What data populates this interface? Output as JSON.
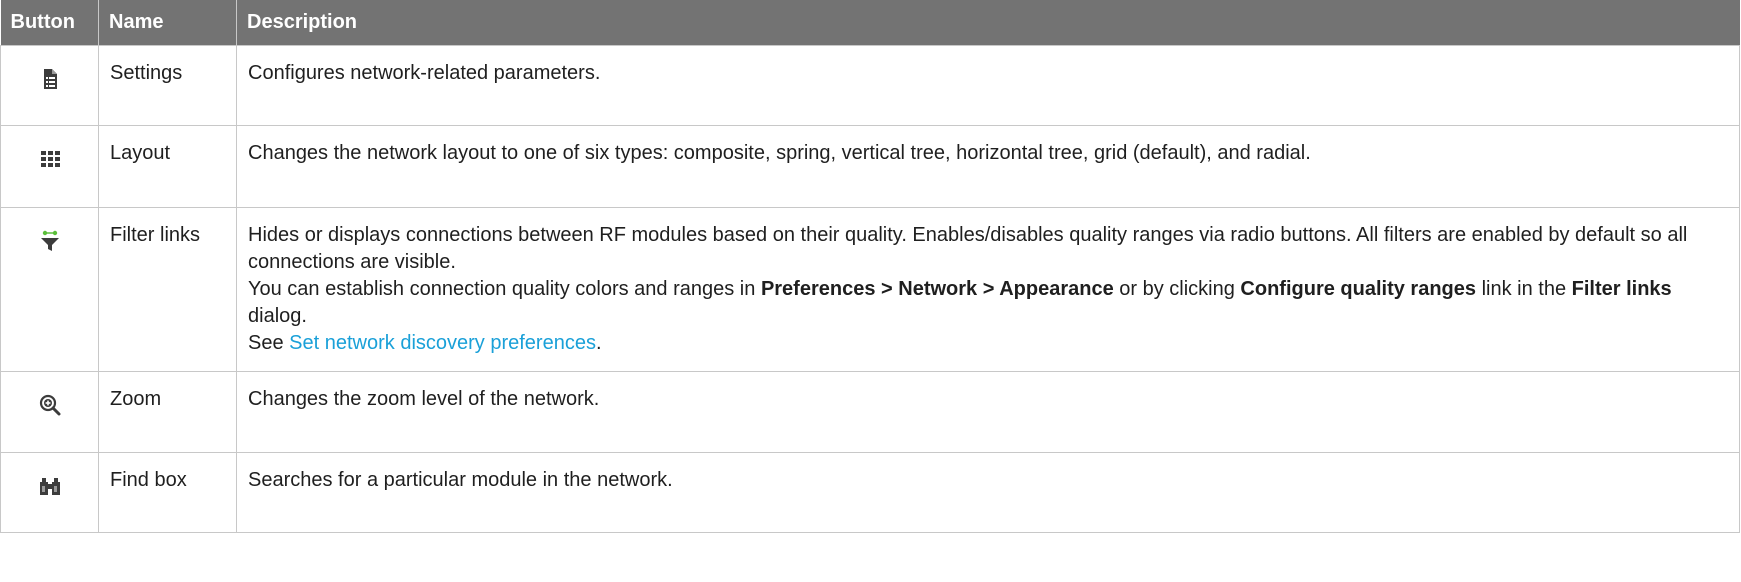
{
  "headers": {
    "button": "Button",
    "name": "Name",
    "description": "Description"
  },
  "rows": [
    {
      "icon": "settings-document-icon",
      "name": "Settings",
      "description": "Configures network-related parameters."
    },
    {
      "icon": "grid-layout-icon",
      "name": "Layout",
      "description": "Changes the network layout to one of six types: composite, spring, vertical tree, horizontal tree, grid (default), and radial."
    },
    {
      "icon": "filter-funnel-icon",
      "name": "Filter links",
      "description_1": "Hides or displays connections between RF modules based on their quality. Enables/disables quality ranges via radio buttons. All filters are enabled by default so all connections are visible.",
      "description_2a": "You can establish connection quality colors and ranges in ",
      "description_2b": "Preferences > Network > Appearance",
      "description_2c": " or by clicking ",
      "description_2d": "Configure quality ranges",
      "description_2e": " link in the ",
      "description_2f": "Filter links",
      "description_2g": " dialog.",
      "description_3a": "See ",
      "description_3b": "Set network discovery preferences",
      "description_3c": "."
    },
    {
      "icon": "zoom-in-icon",
      "name": "Zoom",
      "description": "Changes the zoom level of the network."
    },
    {
      "icon": "binoculars-icon",
      "name": "Find box",
      "description": "Searches for a particular module in the network."
    }
  ],
  "colors": {
    "header_bg": "#737373",
    "link": "#1aa0d8",
    "icon_green": "#5bbf3a",
    "icon_dark": "#3c3c3c"
  }
}
